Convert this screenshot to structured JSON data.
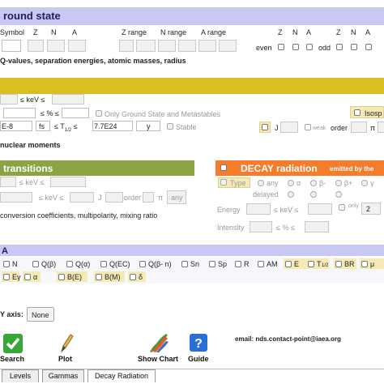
{
  "ground_state": {
    "title": "round state",
    "col_symbol": "Symbol",
    "col_z": "Z",
    "col_n": "N",
    "col_a": "A",
    "col_zrange": "Z range",
    "col_nrange": "N range",
    "col_arange": "A range",
    "even": "even",
    "odd": "odd",
    "even_z": "Z",
    "even_n": "N",
    "even_a": "A",
    "odd_z": "Z",
    "odd_n": "N",
    "odd_a": "A",
    "subtitle": "Q-values, separation energies, atomic masses, radius"
  },
  "levels": {
    "kev_label": "≤ keV ≤",
    "pct_label": "≤ % ≤",
    "only_ground": "Only Ground State and Metastables",
    "half_life_min": "E-8",
    "half_life_unit_left": "fs",
    "half_life_sym": "≤ T",
    "half_life_sub": "1/2",
    "half_life_le": "≤",
    "half_life_max": "7.7E24",
    "half_life_unit_right": "y",
    "stable": "Stable",
    "isospin": "Isosp",
    "j_label": "J",
    "weak_label": "weak",
    "order_label": "order",
    "pi_label": "π",
    "nuclear_moments": "nuclear moments"
  },
  "transitions": {
    "title": "transitions",
    "kev1": "≤ keV ≤",
    "kev2": "≤ keV ≤",
    "j_label": "J",
    "order_label": "order",
    "pi_label": "π",
    "any": "any",
    "conversion": "conversion coefficients, multipolarity, mixing ratio"
  },
  "decay": {
    "title": "DECAY radiation",
    "subtitle": "emitted by the",
    "type_label": "Type",
    "any": "any",
    "alpha": "α",
    "beta_minus": "β-",
    "beta_plus": "β+",
    "gamma": "γ",
    "delayed": "delayed",
    "energy_label": "Energy",
    "energy_kev": "≤ keV ≤",
    "only_label": "only",
    "only_value": "2",
    "intensity_label": "Intensity",
    "intensity_pct": "≤ % ≤"
  },
  "y_section": {
    "title": "A",
    "row1": [
      "N",
      "Q(β)",
      "Q(α)",
      "Q(EC)",
      "Q(β- n)",
      "Sn",
      "Sp",
      "R",
      "AM",
      "E",
      "T",
      "BR",
      "μ"
    ],
    "row1_t_sub": "1/2",
    "row2": [
      "Eγ",
      "α",
      "B(E)",
      "B(M)",
      "δ"
    ]
  },
  "y_axis": {
    "label": "Y axis:",
    "value": "None"
  },
  "actions": {
    "search": "Search",
    "plot": "Plot",
    "show_chart": "Show Chart",
    "guide": "Guide",
    "email": "email: nds.contact-point@iaea.org"
  },
  "tabs": [
    "Levels",
    "Gammas",
    "Decay Radiation"
  ],
  "colors": {
    "ground_bar": "#c9c8f3",
    "levels_bar": "#d8bf22",
    "transitions_bar": "#8aa343",
    "decay_bar": "#f47c2a",
    "y_bar": "#c9c8f3",
    "highlight_checkbox": "#f5e9b6"
  }
}
